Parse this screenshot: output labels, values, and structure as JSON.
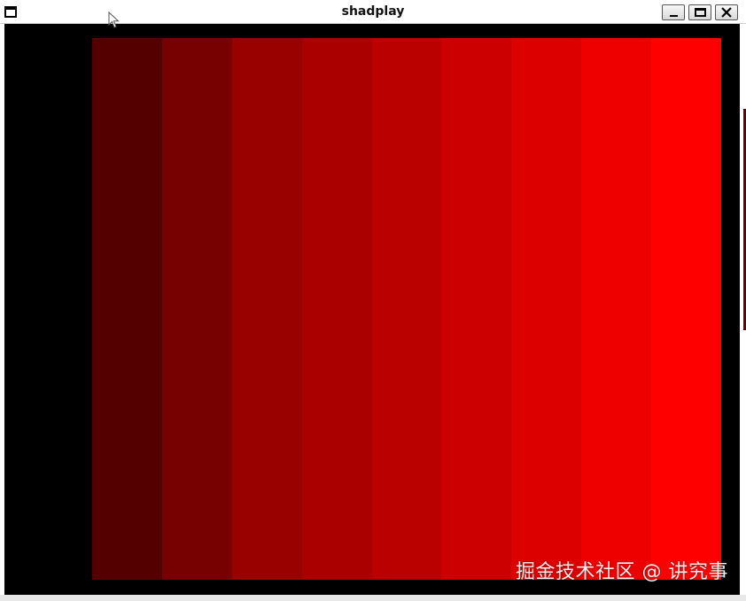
{
  "window": {
    "title": "shadplay"
  },
  "controls": {
    "minimize_icon": "minimize-icon",
    "maximize_icon": "maximize-icon",
    "close_icon": "close-icon"
  },
  "canvas": {
    "background_color": "#000000",
    "bands": [
      {
        "color": "#550000"
      },
      {
        "color": "#770000"
      },
      {
        "color": "#990000"
      },
      {
        "color": "#aa0000"
      },
      {
        "color": "#bb0000"
      },
      {
        "color": "#cc0000"
      },
      {
        "color": "#dd0000"
      },
      {
        "color": "#ee0000"
      },
      {
        "color": "#ff0000"
      }
    ]
  },
  "watermark": {
    "text": "掘金技术社区 @ 讲究事"
  }
}
